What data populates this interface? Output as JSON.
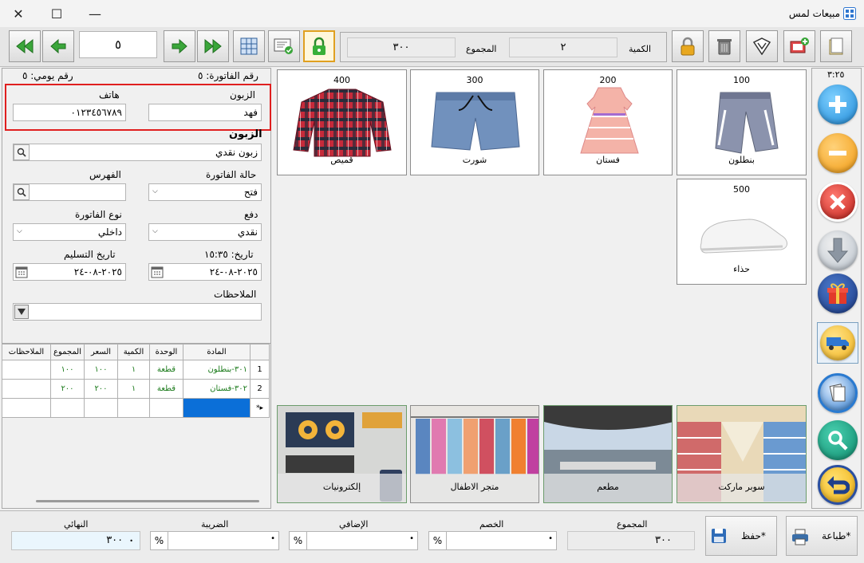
{
  "window": {
    "title": "مبيعات لمس",
    "buttons": {
      "close": "✕",
      "maximize": "☐",
      "minimize": "—"
    }
  },
  "toolbar": {
    "record_number": "٥",
    "total_label": "المجموع",
    "total_value": "٣٠٠",
    "qty_label": "الكمية",
    "qty_value": "٢"
  },
  "invoice": {
    "invoice_no_label": "رقم الفاتورة: ٥",
    "daily_no_label": "رقم يومي: ٥",
    "customer_label": "الزبون",
    "customer_value": "فهد",
    "phone_label": "هاتف",
    "phone_value": "٠١٢٣٤٥٦٧٨٩",
    "customer_section_label": "الزبون",
    "customer_account": "زبون نقدي",
    "status_label": "حالة الفاتورة",
    "status_value": "فتح",
    "index_label": "الفهرس",
    "index_value": "",
    "payment_label": "دفع",
    "payment_value": "نقدي",
    "invoice_type_label": "نوع الفاتورة",
    "invoice_type_value": "داخلي",
    "date_label": "تاريخ: ١٥:٣٥",
    "date_value": "٢٠٢٥-٠٨-٢٤",
    "delivery_label": "تاريخ التسليم",
    "delivery_value": "٢٠٢٥-٠٨-٢٤",
    "notes_label": "الملاحظات",
    "notes_value": ""
  },
  "grid": {
    "headers": [
      "المادة",
      "الوحدة",
      "الكمية",
      "السعر",
      "المجموع",
      "الملاحظات"
    ],
    "rows": [
      {
        "num": "1",
        "item": "٣٠١-بنطلون",
        "unit": "قطعة",
        "qty": "١",
        "price": "١٠٠",
        "total": "١٠٠",
        "notes": ""
      },
      {
        "num": "2",
        "item": "٣٠٢-فستان",
        "unit": "قطعة",
        "qty": "١",
        "price": "٢٠٠",
        "total": "٢٠٠",
        "notes": ""
      }
    ]
  },
  "products": [
    {
      "name": "بنطلون",
      "price": "100"
    },
    {
      "name": "فستان",
      "price": "200"
    },
    {
      "name": "شورت",
      "price": "300"
    },
    {
      "name": "قميص",
      "price": "400"
    },
    {
      "name": "حذاء",
      "price": "500"
    }
  ],
  "categories": [
    {
      "name": "سوبر ماركت"
    },
    {
      "name": "مطعم"
    },
    {
      "name": "متجر الاطفال"
    },
    {
      "name": "إلكترونيات"
    }
  ],
  "side": {
    "time": "٣:٢٥"
  },
  "footer": {
    "print_label": "طباعة*",
    "save_label": "حفظ*",
    "total_label": "المجموع",
    "total_value": "٣٠٠",
    "discount_label": "الخصم",
    "extra_label": "الإضافي",
    "tax_label": "الضريبة",
    "final_label": "النهائي",
    "final_value": "٣٠٠",
    "percent": "%",
    "dot": "•"
  },
  "colors": {
    "accent": "#2f77d0",
    "highlight": "#e01f1f",
    "selected_cell": "#0b6fd8"
  }
}
